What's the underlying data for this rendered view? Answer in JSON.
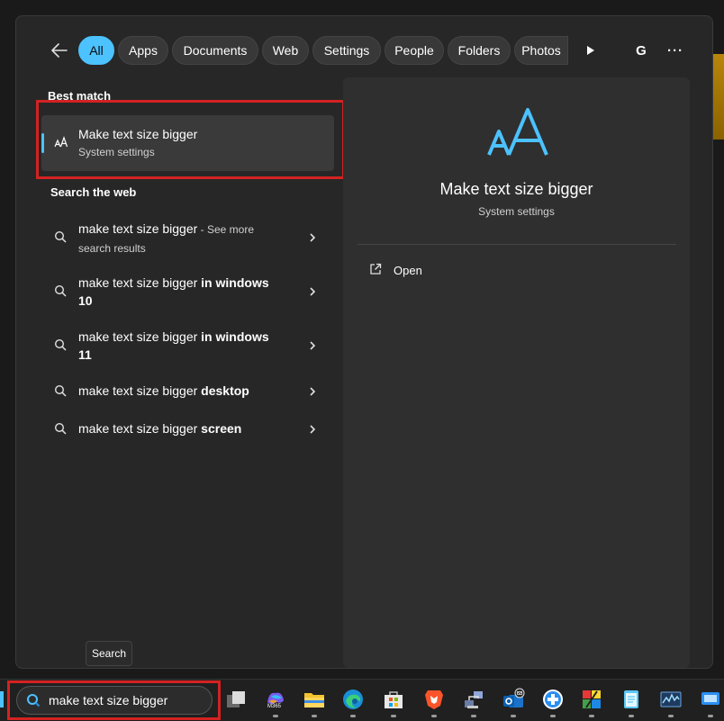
{
  "filters": {
    "active": "All",
    "chips": [
      "All",
      "Apps",
      "Documents",
      "Web",
      "Settings",
      "People",
      "Folders",
      "Photos"
    ],
    "account_initial": "G",
    "more_label": "···"
  },
  "best_match": {
    "heading": "Best match",
    "title": "Make text size bigger",
    "subtitle": "System settings"
  },
  "web": {
    "heading": "Search the web",
    "items": [
      {
        "prefix": "make text size bigger",
        "bold": "",
        "suffix": " - See more",
        "line2": "search results"
      },
      {
        "prefix": "make text size bigger ",
        "bold": "in windows",
        "suffix": "",
        "line2": "10"
      },
      {
        "prefix": "make text size bigger ",
        "bold": "in windows",
        "suffix": "",
        "line2": "11"
      },
      {
        "prefix": "make text size bigger ",
        "bold": "desktop",
        "suffix": "",
        "line2": ""
      },
      {
        "prefix": "make text size bigger ",
        "bold": "screen",
        "suffix": "",
        "line2": ""
      }
    ]
  },
  "preview": {
    "title": "Make text size bigger",
    "subtitle": "System settings",
    "action_open": "Open"
  },
  "tooltip": "Search",
  "taskbar": {
    "search_query": "make text size bigger",
    "apps": [
      "task-view",
      "m365-copilot",
      "file-explorer",
      "edge",
      "microsoft-store",
      "brave",
      "network-tool",
      "outlook",
      "medical-app",
      "color-app",
      "notepad",
      "performance-monitor",
      "remote-app"
    ],
    "m365_label": "M365"
  },
  "colors": {
    "accent": "#4cc2ff",
    "highlight": "#d32222",
    "panel": "#272727",
    "preview": "#2f2f2f"
  }
}
